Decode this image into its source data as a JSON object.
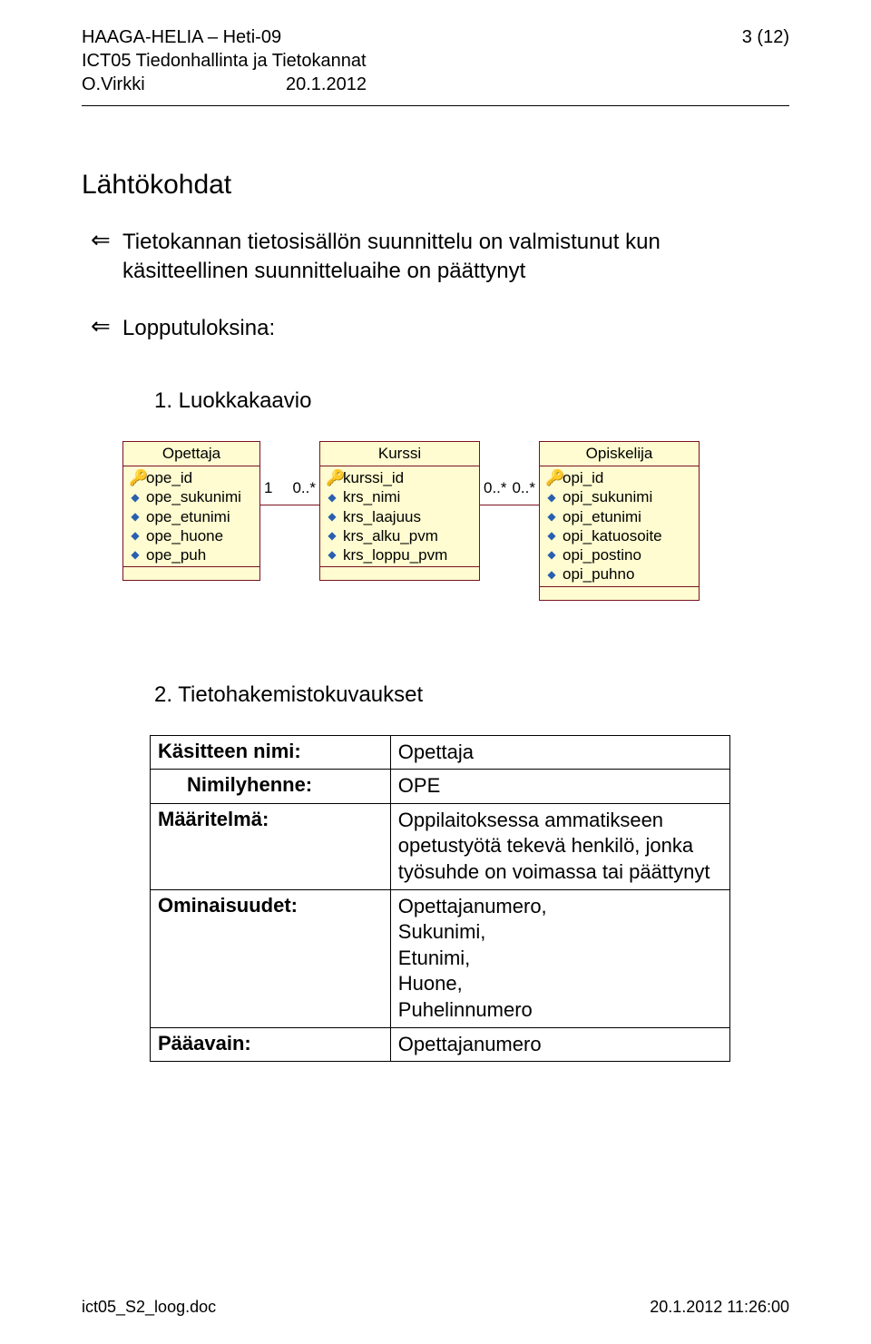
{
  "header": {
    "org": "HAAGA-HELIA – Heti-09",
    "page": "3 (12)",
    "course": "ICT05  Tiedonhallinta ja Tietokannat",
    "author": "O.Virkki",
    "date": "20.1.2012"
  },
  "section_title": "Lähtökohdat",
  "bullets": [
    "Tietokannan tietosisällön suunnittelu on valmistunut kun käsitteellinen suunnitteluaihe on päättynyt",
    "Lopputuloksina:"
  ],
  "num1": "1. Luokkakaavio",
  "uml": {
    "c1": {
      "title": "Opettaja",
      "key": "ope_id",
      "attrs": [
        "ope_sukunimi",
        "ope_etunimi",
        "ope_huone",
        "ope_puh"
      ]
    },
    "a1": {
      "left": "1",
      "right": "0..*"
    },
    "c2": {
      "title": "Kurssi",
      "key": "kurssi_id",
      "attrs": [
        "krs_nimi",
        "krs_laajuus",
        "krs_alku_pvm",
        "krs_loppu_pvm"
      ]
    },
    "a2": {
      "left": "0..*",
      "right": "0..*"
    },
    "c3": {
      "title": "Opiskelija",
      "key": "opi_id",
      "attrs": [
        "opi_sukunimi",
        "opi_etunimi",
        "opi_katuosoite",
        "opi_postino",
        "opi_puhno"
      ]
    }
  },
  "num2": "2. Tietohakemistokuvaukset",
  "def": {
    "r0l": "Käsitteen nimi:",
    "r0v": "Opettaja",
    "r1l": "Nimilyhenne:",
    "r1v": "OPE",
    "r2l": "Määritelmä:",
    "r2v": "Oppilaitoksessa ammatikseen opetustyötä tekevä henkilö, jonka työsuhde on voimassa tai päättynyt",
    "r3l": "Ominaisuudet:",
    "r3v": "Opettajanumero,\nSukunimi,\nEtunimi,\nHuone,\nPuhelinnumero",
    "r4l": "Pääavain:",
    "r4v": "Opettajanumero"
  },
  "footer": {
    "file": "ict05_S2_loog.doc",
    "ts": "20.1.2012 11:26:00"
  }
}
